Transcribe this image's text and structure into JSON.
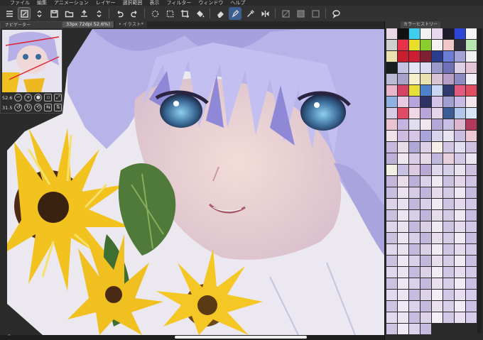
{
  "menu": {
    "items": [
      "ファイル",
      "編集",
      "アニメーション",
      "レイヤー",
      "選択範囲",
      "表示",
      "フィルター",
      "ウィンドウ",
      "ヘルプ"
    ]
  },
  "toolbar": {
    "buttons": [
      "menu-icon",
      "new-canvas-icon",
      "stepper-icon",
      "save-icon",
      "folder-icon",
      "export-icon",
      "stepper-icon",
      "undo-icon",
      "redo-icon",
      "marquee-icon",
      "lasso-icon",
      "transform-icon",
      "fill-icon",
      "eraser-icon",
      "pen-icon",
      "eyedropper-icon",
      "flip-icon",
      "square-icon",
      "square-icon",
      "square-icon",
      "speech-icon"
    ]
  },
  "document": {
    "tabs": [
      {
        "label": "33px 72dpi 52.6%)",
        "active": true
      },
      {
        "label": "• イラスト*",
        "active": false
      }
    ]
  },
  "navigator": {
    "title": "ナビゲーター",
    "zoom_value": "52.6",
    "rotation_value": "31.5"
  },
  "right_panel": {
    "tab_label": "カラーヒストリー",
    "swatches": [
      "#e8d8e4",
      "#111111",
      "#3fcfee",
      "#f2f2f2",
      "#e8d8ee",
      "#1d1d2b",
      "#2d46d8",
      "#f5f5f5",
      "#cfcfcf",
      "#e7324a",
      "#e7df2a",
      "#8acb2e",
      "#f7f2f2",
      "#f0c8c8",
      "#2f2f3b",
      "#b7e6b0",
      "#ece1ae",
      "#c91e2e",
      "#cc1f36",
      "#7e1f33",
      "#2b3d8f",
      "#6b7ed6",
      "#a3a3d8",
      "#f0f0f0",
      "#16201e",
      "#c4c4e2",
      "#e5e5f8",
      "#dbdbf2",
      "#9b9bcb",
      "#7171b8",
      "#ddd0e4",
      "#e4c6d6",
      "#bcbcd8",
      "#a9a2c9",
      "#f6f0cc",
      "#e9e3b2",
      "#d9c4d6",
      "#b79fc7",
      "#8c8ac2",
      "#f2eef6",
      "#e9b7cc",
      "#d44364",
      "#e8e03a",
      "#4b82cb",
      "#c7d7f4",
      "#2f3a6e",
      "#e25a80",
      "#e14e62",
      "#8fb0e0",
      "#e9c9e2",
      "#b7a6dd",
      "#2d3464",
      "#d4c5e8",
      "#a0a0d0",
      "#c7bbe5",
      "#f2e6ec",
      "#d8cde6",
      "#e04b66",
      "#f0d8e6",
      "#b9a6d8",
      "#e6d6ea",
      "#3b5d94",
      "#b0c7ea",
      "#d8e5f6",
      "#e9c4d0",
      "#c3b4e0",
      "#dfdfef",
      "#f1e7ef",
      "#b3a8d6",
      "#c8c0e4",
      "#dcb6cc",
      "#b13a5a",
      "#efe2e9",
      "#cdbbe0",
      "#d6c7e6",
      "#a8a6d8",
      "#d9d4ee",
      "#e8e4f2",
      "#c9bedf",
      "#edc9d6",
      "#c5b8dc",
      "#e7dde9",
      "#b0a9d5",
      "#dbd0e8",
      "#f6eee8",
      "#d0c6e4",
      "#e2e0f0",
      "#cfc2e0",
      "#bdb1d8",
      "#efe8f0",
      "#d9cde7",
      "#e6d9e8",
      "#c0b8dc",
      "#e8d0dc",
      "#d2c9e6",
      "#ebe5f2",
      "#f2f0e4",
      "#c7c0e2",
      "#dccbe1",
      "#b7a9d4",
      "#e0d8ec",
      "#d5cfe9",
      "#e9e2ef",
      "#cdc1df",
      "#c4b7da",
      "#e8dde8",
      "#bbb0d8",
      "#d9d2ea",
      "#f0ebf2",
      "#cbc2e2",
      "#e2d6e8",
      "#d0c5e4",
      "#c8bedf",
      "#eae3ef",
      "#d6cce6",
      "#bfb5da",
      "#e5dbea",
      "#d3cae6",
      "#ece7f2",
      "#c6bcdd",
      "#dcd3ea",
      "#e7e0ee",
      "#c2b8dc",
      "#d8cfe8",
      "#efe9f2",
      "#cdc4e2",
      "#e3dbec",
      "#d1c8e5",
      "#c9c0e0",
      "#ebe5f1",
      "#d7cee8",
      "#c0b6db",
      "#e6ddeb",
      "#d4cbe7",
      "#ede8f2",
      "#c7bedf",
      "#ddd5eb",
      "#e8e2ef",
      "#c3b9dc",
      "#d9d0e8",
      "#f0eaf3",
      "#cec5e3",
      "#e4dced",
      "#d2c9e6",
      "#cac1e1",
      "#ece6f2",
      "#d8cfe9",
      "#c1b7db",
      "#e7deeb",
      "#d5cce7",
      "#eee9f3",
      "#c8bfe0",
      "#dfd7ec",
      "#e9e3f0",
      "#c4badd",
      "#dad1e9",
      "#f1ebf4",
      "#cfc6e4",
      "#e5ddee",
      "#d3cae7",
      "#cbc2e2",
      "#ede7f3",
      "#d9d0ea",
      "#c2b8dc",
      "#e8dfec",
      "#d6cde8",
      "#efeaf4",
      "#c9c0e1",
      "#e0d8ed",
      "#eae4f1",
      "#c5bbde",
      "#dbd2ea",
      "#f2ecf5",
      "#d0c7e5",
      "#e6deef",
      "#d4cbe8",
      "#ccc3e3",
      "#eee8f4",
      "#dad1eb",
      "#c3b9dd",
      "#e9e0ed",
      "#d7cee9",
      "#f0ebf5",
      "#cac1e2",
      "#e1d9ee",
      "#ebe5f2",
      "#c6bcdf",
      "#dcd3eb",
      "#f3edf6",
      "#d1c8e6",
      "#e7dff0",
      "#d5cce9",
      "#cdc4e4",
      "#efe9f5",
      "#dbd2ec",
      "#c4badd",
      "#eae1ee",
      "#d8cfea",
      "#f1ecf6",
      "#cbc2e3",
      "#e2daef",
      "#ece6f3",
      "#c7bde0",
      "#ddd4ec",
      "#f4eef7",
      "#d2c9e7",
      "#e8e0f1",
      "#d6cdea",
      "#cec5e5",
      "#f0eaf6",
      "#dcd3ed",
      "#c5bbde"
    ]
  }
}
